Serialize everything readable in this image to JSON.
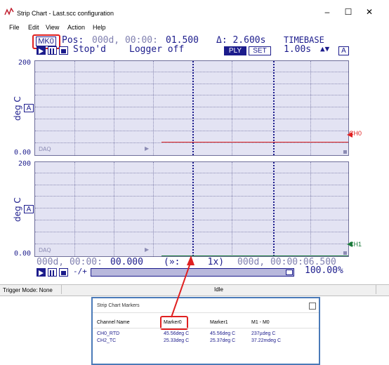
{
  "window": {
    "title": "Strip Chart - Last.scc configuration",
    "minimize": "–",
    "maximize": "☐",
    "close": "✕"
  },
  "menu": [
    "File",
    "Edit",
    "View",
    "Action",
    "Help"
  ],
  "header": {
    "marker": "MK0",
    "pos_label": "Pos:",
    "pos_value_dim": "000d, 00:00:",
    "pos_value_bright": "01.500",
    "delta": "Δ: 2.600s",
    "timebase_label": "TIMEBASE",
    "state": "Stop'd",
    "logger": "Logger off",
    "ply": "PLY",
    "set": "SET",
    "timebase_value": "1.00s",
    "timebase_arrows": "▲▼",
    "auto": "A"
  },
  "plots": [
    {
      "ymax": "200",
      "ymin": "0.00",
      "unit": "deg C",
      "auto": "A",
      "daq": "DAQ",
      "channel": "CH0",
      "color": "#e02020",
      "level": 0.1306
    },
    {
      "ymax": "200",
      "ymin": "0.00",
      "unit": "deg C",
      "auto": "A",
      "daq": "DAQ",
      "channel": "CH1",
      "color": "#1a7a3a",
      "level": 0.0
    }
  ],
  "footer": {
    "start_dim": "000d, 00:00:",
    "start_bright": "00.000",
    "zoom": "(»:     1x)",
    "end": "000d, 00:00:06.500",
    "step": "-/+",
    "zoom_pct": "100.00%"
  },
  "status": {
    "trigger_mode": "Trigger Mode:  None",
    "state": "Idle"
  },
  "markers_window": {
    "title": "Strip Chart Markers",
    "headers": [
      "Channel Name",
      "Marker0",
      "Marker1",
      "M1 - M0"
    ],
    "rows": [
      [
        "CH0_RTD",
        "45.56deg C",
        "45.56deg C",
        "237µdeg C"
      ],
      [
        "CH2_TC",
        "25.33deg C",
        "25.37deg C",
        "37.22mdeg C"
      ]
    ]
  },
  "colors": {
    "accent": "#1c1c8c",
    "annotation": "#e02020"
  }
}
